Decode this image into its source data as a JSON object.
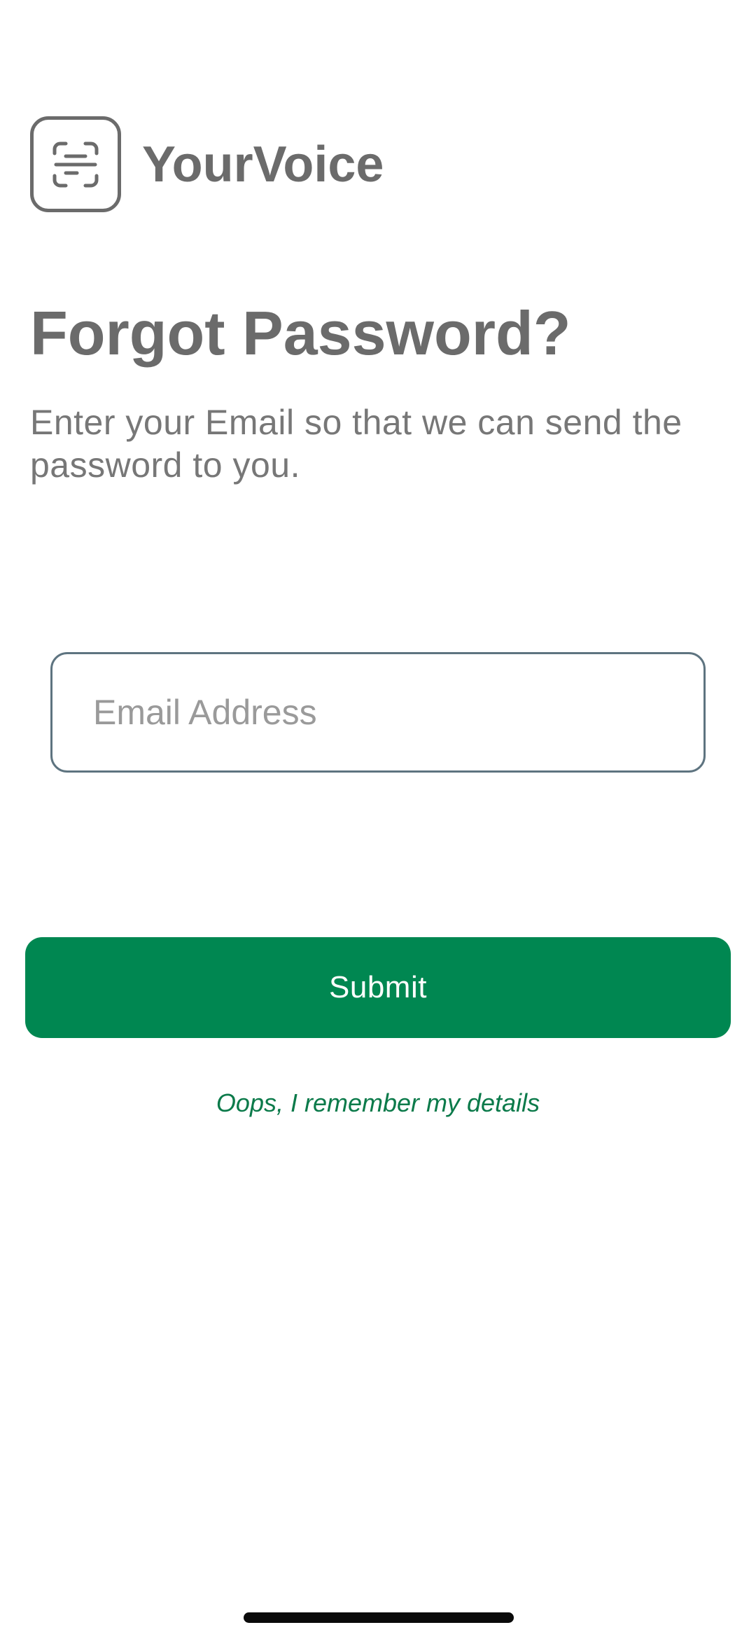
{
  "app": {
    "name": "YourVoice",
    "logo_icon": "scan-text-icon"
  },
  "page": {
    "title": "Forgot Password?",
    "subtitle": "Enter your Email so that we can send the password to you."
  },
  "form": {
    "email_placeholder": "Email Address",
    "email_value": "",
    "submit_label": "Submit"
  },
  "links": {
    "remember_label": "Oops, I remember my details"
  },
  "colors": {
    "brand_gray": "#6b6b6b",
    "accent_green": "#008751",
    "link_green": "#0b7a4a",
    "field_border": "#5e7480"
  }
}
